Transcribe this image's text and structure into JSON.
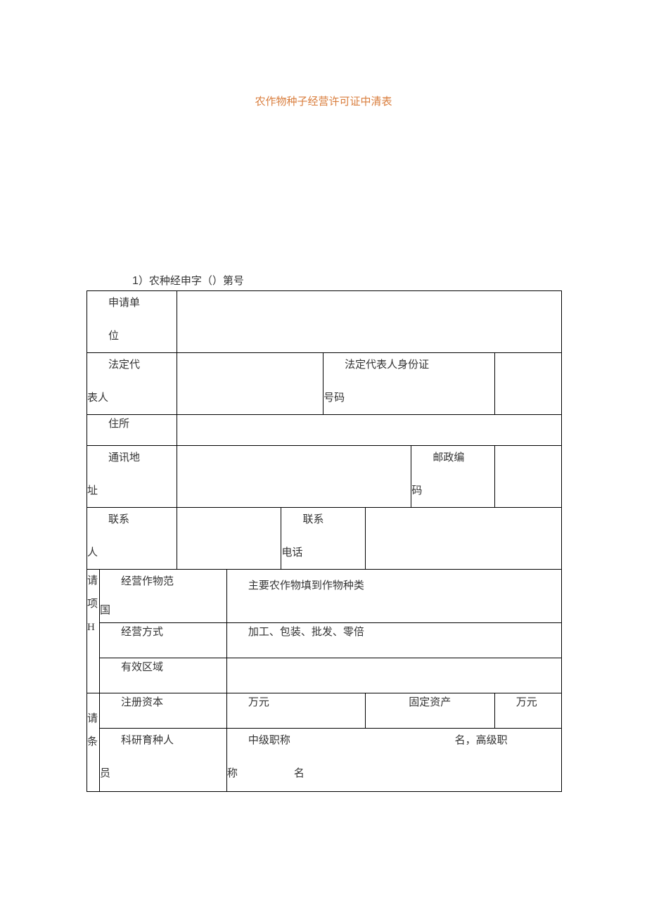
{
  "title": "农作物种子经营许可证中清表",
  "form_number_prefix": "1",
  "form_number_text": "）农种经申字（）第号",
  "rows": {
    "applicant_unit": "申请单位",
    "legal_rep": "法定代表人",
    "legal_rep_id": "法定代表人身份证号码",
    "address": "住所",
    "mailing_addr": "通讯地址",
    "postal_code": "邮政编码",
    "contact_person": "联系人",
    "contact_phone": "联系电话",
    "apply_items": "请项H",
    "crop_scope": "经营作物范国",
    "crop_scope_val": "主要农作物填到作物种类",
    "business_mode": "经营方式",
    "business_mode_val": "加工、包装、批发、零倍",
    "valid_area": "有效区域",
    "apply_cond": "请条",
    "reg_capital": "注册资本",
    "wan_yuan": "万元",
    "fixed_assets": "固定资产",
    "wan_yuan2": "万元",
    "research_staff": "科研育种人员",
    "mid_title_prefix": "中级职称",
    "mid_title_suffix": "名",
    "senior_prefix": "名，高级职称",
    "senior_suffix": ""
  }
}
